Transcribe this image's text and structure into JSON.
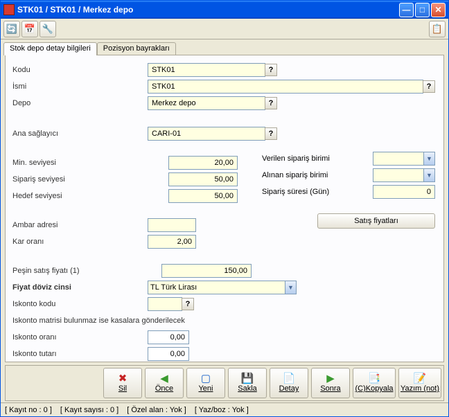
{
  "title": "STK01 / STK01 / Merkez depo",
  "tabs": {
    "t1": "Stok depo detay bilgileri",
    "t2": "Pozisyon bayrakları"
  },
  "labels": {
    "kodu": "Kodu",
    "ismi": "İsmi",
    "depo": "Depo",
    "ana_saglayici": "Ana sağlayıcı",
    "min_seviyesi": "Min. seviyesi",
    "siparis_seviyesi": "Sipariş seviyesi",
    "hedef_seviyesi": "Hedef seviyesi",
    "ambar_adresi": "Ambar adresi",
    "kar_orani": "Kar oranı",
    "pesin_satis": "Peşin satış fiyatı (1)",
    "fiyat_doviz": "Fiyat döviz cinsi",
    "iskonto_kodu": "Iskonto kodu",
    "iskonto_matrisi": "Iskonto matrisi bulunmaz ise kasalara gönderilecek",
    "iskonto_orani": "Iskonto oranı",
    "iskonto_tutari": "Iskonto tutarı",
    "verilen_siparis": "Verilen sipariş birimi",
    "alinan_siparis": "Alınan sipariş birimi",
    "siparis_suresi": "Sipariş süresi (Gün)",
    "satis_fiyatlari": "Satış fiyatları"
  },
  "values": {
    "kodu": "STK01",
    "ismi": "STK01",
    "depo": "Merkez depo",
    "ana_saglayici": "CARI-01",
    "min_seviyesi": "20,00",
    "siparis_seviyesi": "50,00",
    "hedef_seviyesi": "50,00",
    "ambar_adresi": "",
    "kar_orani": "2,00",
    "pesin_satis": "150,00",
    "fiyat_doviz": "TL  Türk Lirası",
    "iskonto_kodu": "",
    "iskonto_orani": "0,00",
    "iskonto_tutari": "0,00",
    "verilen_siparis": "",
    "alinan_siparis": "",
    "siparis_suresi": "0"
  },
  "buttons": {
    "sil": "Sil",
    "once": "Önce",
    "yeni": "Yeni",
    "sakla": "Sakla",
    "detay": "Detay",
    "sonra": "Sonra",
    "kopyala": "(C)Kopyala",
    "yazim": "Yazım (not)"
  },
  "glyphs": {
    "q": "?"
  },
  "status": {
    "kayit_no": "[ Kayıt no : 0 ]",
    "kayit_sayisi": "[ Kayıt sayısı : 0 ]",
    "ozel_alan": "[ Özel alan : Yok ]",
    "yazboz": "[ Yaz/boz : Yok ]"
  }
}
